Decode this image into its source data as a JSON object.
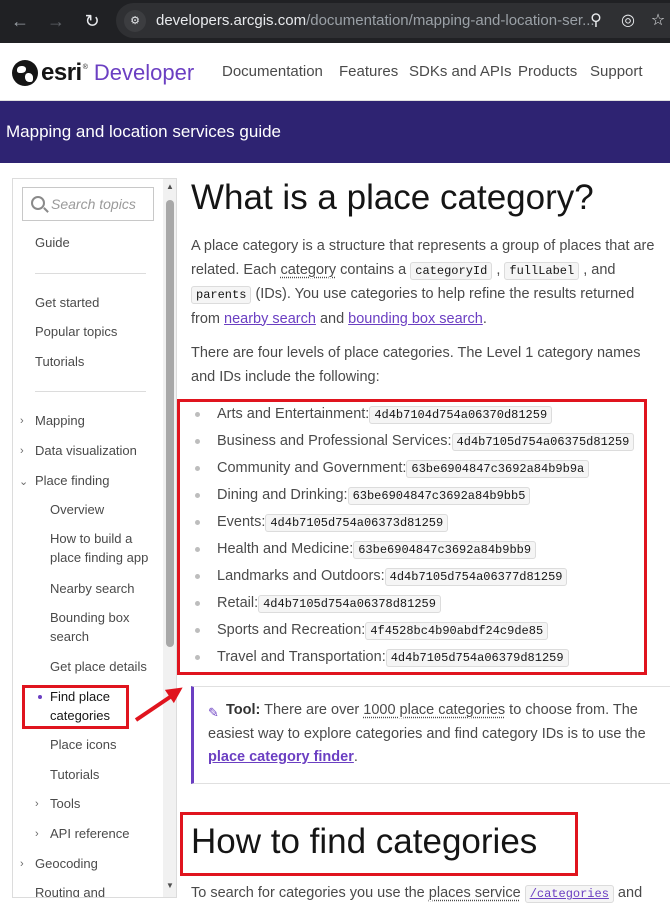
{
  "browser": {
    "url_domain": "developers.arcgis.com",
    "url_path": "/documentation/mapping-and-location-ser...",
    "back_icon": "←",
    "forward_icon": "→",
    "reload_icon": "↻"
  },
  "header": {
    "logo_text": "esri",
    "logo_tm": "®",
    "developer_label": "Developer",
    "nav": [
      "Documentation",
      "Features",
      "SDKs and APIs",
      "Products",
      "Support"
    ]
  },
  "banner": {
    "title": "Mapping and location services guide"
  },
  "sidebar": {
    "search_placeholder": "Search topics",
    "guide": "Guide",
    "get_started": "Get started",
    "popular_topics": "Popular topics",
    "tutorials": "Tutorials",
    "mapping": "Mapping",
    "data_visualization": "Data visualization",
    "place_finding": "Place finding",
    "overview": "Overview",
    "how_to_build": "How to build a place finding app",
    "nearby_search": "Nearby search",
    "bounding_box_search": "Bounding box search",
    "get_place_details": "Get place details",
    "find_place_categories": "Find place categories",
    "place_icons": "Place icons",
    "sub_tutorials": "Tutorials",
    "tools": "Tools",
    "api_reference": "API reference",
    "geocoding": "Geocoding",
    "routing": "Routing and"
  },
  "main": {
    "title": "What is a place category?",
    "intro": {
      "t1": "A place category is a structure that represents a group of places that are related. Each ",
      "category_word": "category",
      "t2": " contains a ",
      "code1": "categoryId",
      "t3": " , ",
      "code2": "fullLabel",
      "t4": " , and ",
      "code3": "parents",
      "t5": " (IDs). You use categories to help refine the results returned from ",
      "link1": "nearby search",
      "t6": " and ",
      "link2": "bounding box search",
      "t7": "."
    },
    "levels_text": "There are four levels of place categories. The Level 1 category names and IDs include the following:",
    "categories": [
      {
        "name": "Arts and Entertainment:",
        "id": "4d4b7104d754a06370d81259"
      },
      {
        "name": "Business and Professional Services:",
        "id": "4d4b7105d754a06375d81259"
      },
      {
        "name": "Community and Government:",
        "id": "63be6904847c3692a84b9b9a"
      },
      {
        "name": "Dining and Drinking:",
        "id": "63be6904847c3692a84b9bb5"
      },
      {
        "name": "Events:",
        "id": "4d4b7105d754a06373d81259"
      },
      {
        "name": "Health and Medicine:",
        "id": "63be6904847c3692a84b9bb9"
      },
      {
        "name": "Landmarks and Outdoors:",
        "id": "4d4b7105d754a06377d81259"
      },
      {
        "name": "Retail:",
        "id": "4d4b7105d754a06378d81259"
      },
      {
        "name": "Sports and Recreation:",
        "id": "4f4528bc4b90abdf24c9de85"
      },
      {
        "name": "Travel and Transportation:",
        "id": "4d4b7105d754a06379d81259"
      }
    ],
    "tool": {
      "label": "Tool:",
      "t1": " There are over ",
      "count_link": "1000 place categories",
      "t2": " to choose from. The easiest way to explore categories and find category IDs is to use the ",
      "finder_link": "place category finder",
      "t3": "."
    },
    "h2": "How to find categories",
    "find_text": {
      "t1": "To search for categories you use the ",
      "service_link": "places service",
      "code": "/categories",
      "t2": " and"
    }
  },
  "colors": {
    "brand_purple": "#6b3fc2",
    "banner_bg": "#2e2372",
    "highlight_red": "#e0141e"
  }
}
